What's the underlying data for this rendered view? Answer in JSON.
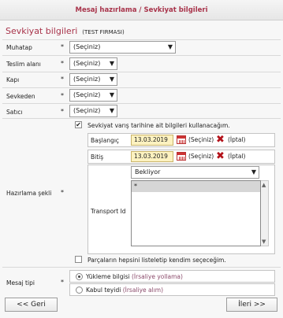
{
  "window": {
    "title": "Mesaj hazırlama / Sevkiyat bilgileri"
  },
  "heading": {
    "title": "Sevkiyat bilgileri",
    "firm": "(TEST FIRMASI)"
  },
  "required_marker": "*",
  "fields": {
    "muhatap": {
      "label": "Muhatap",
      "value": "(Seçiniz)"
    },
    "teslim_alani": {
      "label": "Teslim alanı",
      "value": "(Seçiniz)"
    },
    "kapi": {
      "label": "Kapı",
      "value": "(Seçiniz)"
    },
    "sevkeden": {
      "label": "Sevkeden",
      "value": "(Seçiniz)"
    },
    "satici": {
      "label": "Satıcı",
      "value": "(Seçiniz)"
    }
  },
  "hazirlama": {
    "label": "Hazırlama şekli",
    "use_arrival_date": {
      "label": "Sevkiyat varış tarihine ait bilgileri kullanacağım.",
      "checked": true
    },
    "start": {
      "label": "Başlangıç",
      "date": "13.03.2019",
      "select_label": "(Seçiniz)",
      "cancel_label": "(İptal)"
    },
    "end": {
      "label": "Bitiş",
      "date": "13.03.2019",
      "select_label": "(Seçiniz)",
      "cancel_label": "(İptal)"
    },
    "transport": {
      "label": "Transport Id",
      "status_value": "Bekliyor",
      "list_items": [
        "*"
      ]
    },
    "select_all_parts": {
      "label": "Parçaların hepsini listeletip kendim seçeceğim.",
      "checked": false
    }
  },
  "mesaj_tipi": {
    "label": "Mesaj tipi",
    "options": [
      {
        "label": "Yükleme bilgisi",
        "suffix": "(İrsaliye yollama)",
        "selected": true
      },
      {
        "label": "Kabul teyidi",
        "suffix": "(İrsaliye alım)",
        "selected": false
      }
    ]
  },
  "buttons": {
    "back": "<< Geri",
    "next": "İleri >>"
  },
  "colors": {
    "accent": "#a8334a",
    "date_bg": "#fdf2c0",
    "cancel_icon": "#b3121a"
  },
  "icons": [
    "calendar-icon",
    "cancel-x-icon",
    "checkbox-checked",
    "radio-selected",
    "dropdown-arrow-icon"
  ]
}
